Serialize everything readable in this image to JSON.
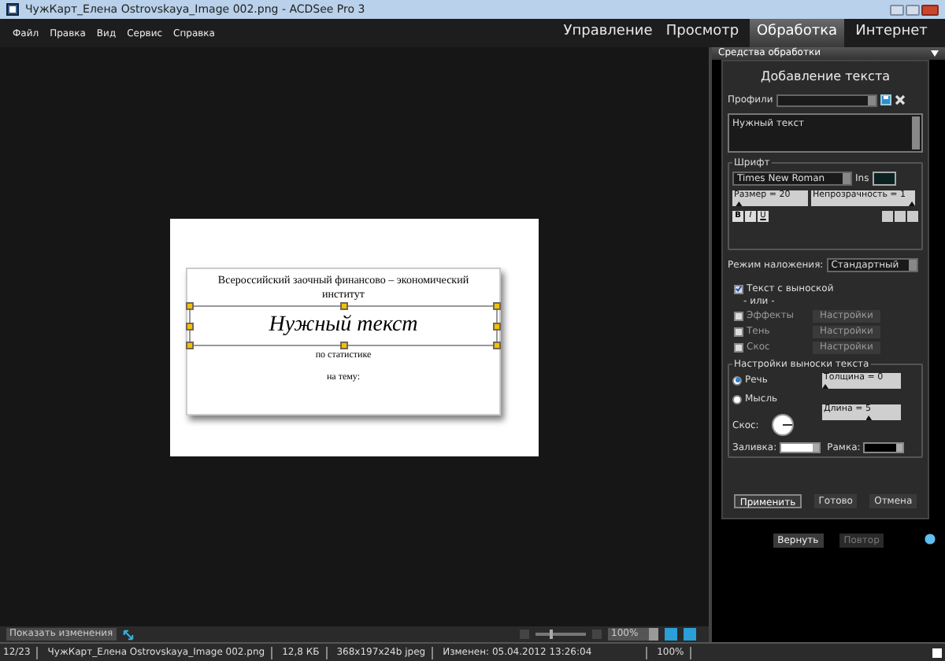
{
  "window": {
    "title": "ЧужКарт_Елена Ostrovskaya_Image 002.png - ACDSee Pro 3"
  },
  "menu": [
    "Файл",
    "Правка",
    "Вид",
    "Сервис",
    "Справка"
  ],
  "mode_tabs": [
    {
      "label": "Управление",
      "selected": false
    },
    {
      "label": "Просмотр",
      "selected": false
    },
    {
      "label": "Обработка",
      "selected": true
    },
    {
      "label": "Интернет",
      "selected": false
    }
  ],
  "document": {
    "heading": "Всероссийский  заочный финансово – экономический институт",
    "text_box": "Нужный текст",
    "subject": "по статистике",
    "topic": "на тему:"
  },
  "panel": {
    "header": "Средства обработки",
    "title": "Добавление текста",
    "profiles_label": "Профили",
    "text_value": "Нужный текст",
    "font": {
      "group_label": "Шрифт",
      "family": "Times New Roman",
      "color_label": "Ins",
      "sliders": [
        {
          "reading": "Размер = 20",
          "level": 0.05
        },
        {
          "reading": "Непрозрачность = 1",
          "level": 1
        }
      ],
      "styles": [
        "B",
        "I",
        "U"
      ]
    },
    "blend_label": "Режим наложения:",
    "blend_value": "Стандартный",
    "callout": {
      "label": "Текст с выноской",
      "checked": true
    },
    "or_label": "- или -",
    "effects": [
      {
        "label": "Эффекты",
        "checked": false,
        "button": "Настройки"
      },
      {
        "label": "Тень",
        "checked": false,
        "button": "Настройки"
      },
      {
        "label": "Скос",
        "checked": false,
        "button": "Настройки"
      }
    ],
    "callout_settings": {
      "group_label": "Настройки выноски текста",
      "types": [
        {
          "label": "Речь",
          "selected": true
        },
        {
          "label": "Мысль",
          "selected": false
        }
      ],
      "bevel_label": "Скос:",
      "sliders": [
        {
          "reading": "Толщина = 0",
          "level": 0
        },
        {
          "reading": "Длина = 5",
          "level": 0.6
        }
      ],
      "fill_label": "Заливка:",
      "frame_label": "Рамка:"
    },
    "actions": [
      "Применить",
      "Готово",
      "Отмена"
    ]
  },
  "history_buttons": [
    {
      "label": "Вернуть",
      "disabled": false
    },
    {
      "label": "Повтор",
      "disabled": true
    }
  ],
  "toolbar": {
    "show_changes": "Показать изменения",
    "zoom_slider": {
      "level": 0.3
    },
    "zoom": "100%"
  },
  "status_bar": [
    "12/23",
    "ЧужКарт_Елена Ostrovskaya_Image 002.png",
    "12,8 КБ",
    "368x197x24b jpeg",
    "Изменен: 05.04.2012 13:26:04",
    "100%"
  ]
}
